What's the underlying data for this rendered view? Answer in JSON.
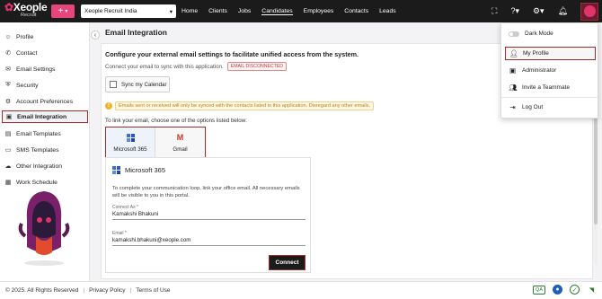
{
  "topbar": {
    "logo_brand": "Xeople",
    "logo_sub": "Recruit",
    "org_name": "Xeople Recruit India",
    "nav": [
      "Home",
      "Clients",
      "Jobs",
      "Candidates",
      "Employees",
      "Contacts",
      "Leads"
    ],
    "active_nav": "Candidates"
  },
  "sidebar": {
    "items": [
      {
        "label": "Profile",
        "icon": "user-icon"
      },
      {
        "label": "Contact",
        "icon": "phone-icon"
      },
      {
        "label": "Email Settings",
        "icon": "mail-icon"
      },
      {
        "label": "Security",
        "icon": "shield-icon"
      },
      {
        "label": "Account Preferences",
        "icon": "settings-icon"
      },
      {
        "label": "Email Integration",
        "icon": "integration-icon",
        "active": true
      },
      {
        "label": "Email Templates",
        "icon": "template-icon"
      },
      {
        "label": "SMS Templates",
        "icon": "sms-icon"
      },
      {
        "label": "Other Integration",
        "icon": "cloud-icon"
      },
      {
        "label": "Work Schedule",
        "icon": "calendar-icon"
      }
    ]
  },
  "main": {
    "title": "Email Integration",
    "heading": "Configure your external email settings to facilitate unified access from the system.",
    "subline": "Connect your email to sync with this application.",
    "status_badge": "EMAIL DISCONNECTED",
    "sync_label": "Sync my Calendar",
    "warning": "Emails sent or received will only be synced with the contacts listed in this application. Disregard any other emails.",
    "link_line": "To link your email, choose one of the options listed below:",
    "options": [
      "Microsoft 365",
      "Gmail"
    ],
    "card": {
      "title": "Microsoft 365",
      "desc": "To complete your communication loop, link your office email. All necessary emails will be visible to you in this portal.",
      "connect_as_label": "Connect As *",
      "connect_as_value": "Kamakshi Bhakuni",
      "email_label": "Email *",
      "email_value": "kamakshi.bhakuni@xeople.com",
      "connect_button": "Connect"
    }
  },
  "dropdown": {
    "items": [
      "Dark Mode",
      "My Profile",
      "Administrator",
      "Invite a Teammate",
      "Log Out"
    ]
  },
  "footer": {
    "copyright": "© 2025. All Rights Reserved",
    "privacy": "Privacy Policy",
    "terms": "Terms of Use",
    "qa": "QA"
  },
  "colors": {
    "accent": "#e8457d",
    "highlight_border": "#a52a2a",
    "topbar": "#1b1b1b"
  }
}
